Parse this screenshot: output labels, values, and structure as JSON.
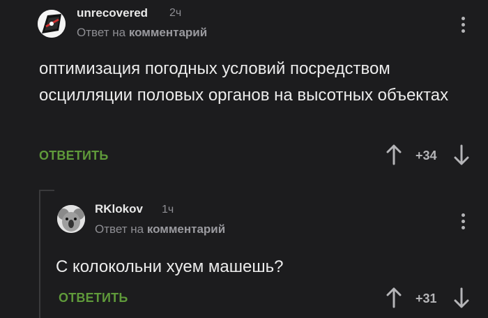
{
  "comments": [
    {
      "username": "unrecovered",
      "time": "2ч",
      "reply_prefix": "Ответ на",
      "reply_target": "комментарий",
      "text": "оптимизация погодных условий посредством осцилляции половых органов на высотных объектах",
      "reply_label": "ОТВЕТИТЬ",
      "score": "+34",
      "avatar_icon": "mask-avatar-icon"
    },
    {
      "username": "RKlokov",
      "time": "1ч",
      "reply_prefix": "Ответ на",
      "reply_target": "комментарий",
      "text": "С колокольни хуем машешь?",
      "reply_label": "ОТВЕТИТЬ",
      "score": "+31",
      "avatar_icon": "koala-avatar-icon"
    }
  ],
  "colors": {
    "background": "#1c1c1e",
    "accent_green": "#5f9a3a",
    "muted_text": "#8e8e93"
  }
}
